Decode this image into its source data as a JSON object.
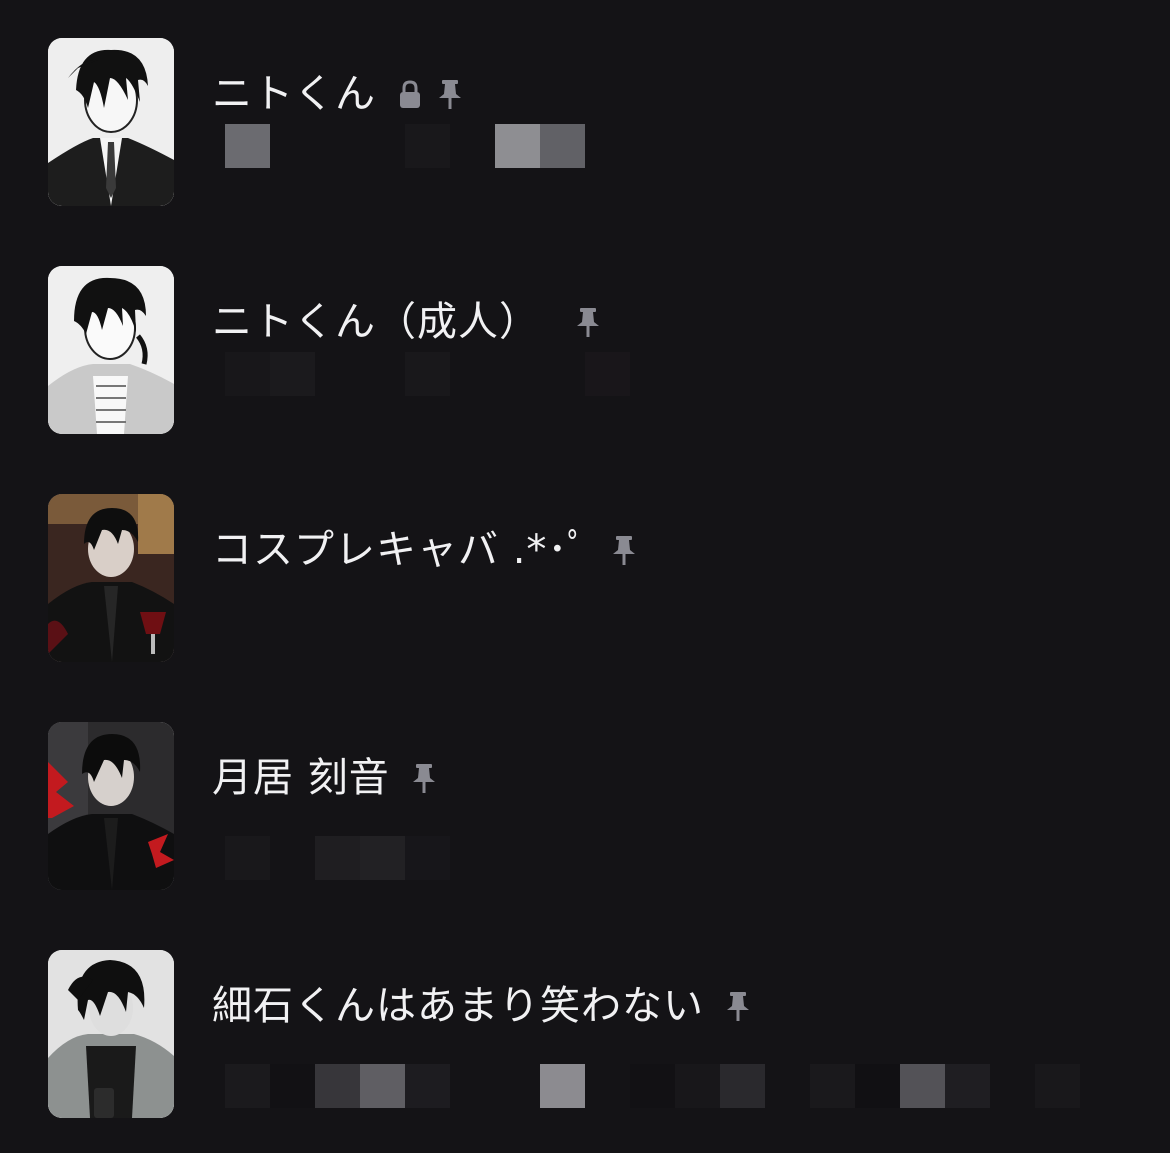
{
  "colors": {
    "background": "#141316",
    "text": "#f1f1f3",
    "icon": "#8a8a92"
  },
  "chats": [
    {
      "name": "ニトくん",
      "icons": [
        "lock-icon",
        "pin-icon"
      ],
      "avatar": "monochrome-portrait-suit"
    },
    {
      "name": "ニトくん（成人）",
      "icons": [
        "pin-icon"
      ],
      "avatar": "monochrome-portrait-hoodie"
    },
    {
      "name": "コスプレキャバ .*･ﾟ",
      "icons": [
        "pin-icon"
      ],
      "avatar": "dark-portrait-wine-glass"
    },
    {
      "name": "月居 刻音",
      "icons": [
        "pin-icon"
      ],
      "avatar": "dark-portrait-red-splash"
    },
    {
      "name": "細石くんはあまり笑わない",
      "icons": [
        "pin-icon"
      ],
      "avatar": "dark-portrait-fur-coat"
    }
  ]
}
